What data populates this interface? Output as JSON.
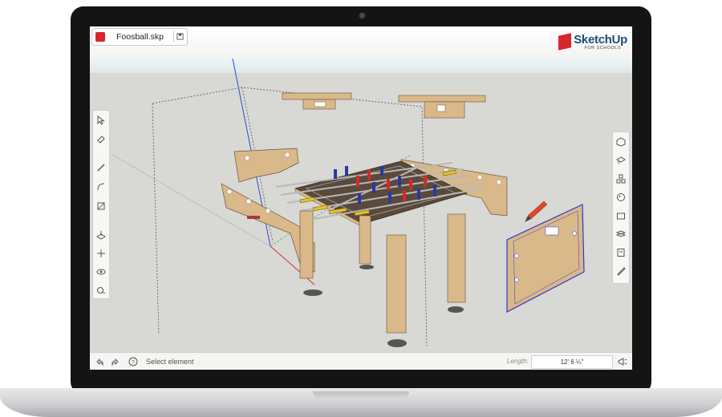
{
  "app": {
    "file_name": "Foosball.skp",
    "brand_name": "SketchUp",
    "brand_subtitle": "FOR SCHOOLS"
  },
  "status": {
    "hint": "Select element",
    "length_label": "Length:",
    "length_value": "12' 6 ¼\""
  },
  "colors": {
    "accent": "#d7262b",
    "brand": "#1d4f7a",
    "wood": "#d9b98a",
    "selection": "#3333cc"
  },
  "icons": {
    "left_toolbar": [
      "select-icon",
      "eraser-icon",
      "pencil-icon",
      "arc-icon",
      "rectangle-icon",
      "push-pull-icon",
      "move-icon",
      "orbit-icon",
      "tape-measure-icon"
    ],
    "right_toolbar": [
      "components-icon",
      "warehouse-icon",
      "outliner-icon",
      "materials-icon",
      "scenes-icon",
      "layers-icon",
      "entity-info-icon",
      "display-icon"
    ],
    "status_toolbar": [
      "undo-icon",
      "redo-icon",
      "help-icon",
      "share-icon"
    ]
  }
}
